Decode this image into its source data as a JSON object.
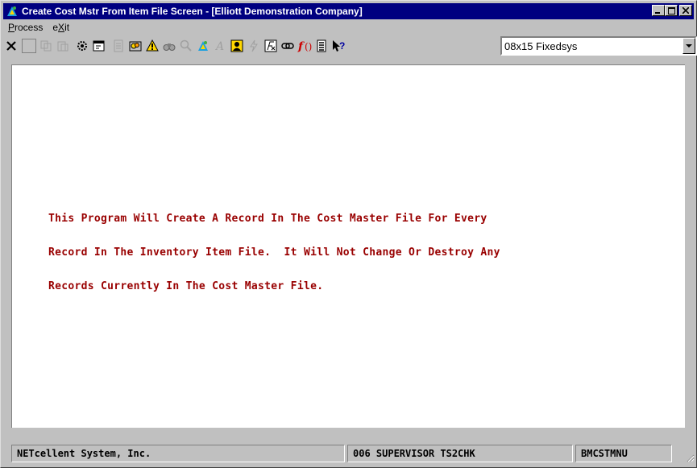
{
  "window": {
    "title": "Create Cost Mstr From Item File Screen - [Elliott Demonstration Company]",
    "controls": {
      "minimize": "_",
      "maximize": "□",
      "close": "×"
    }
  },
  "menu": {
    "items": [
      {
        "label_pre": "",
        "label_u": "P",
        "label_post": "rocess"
      },
      {
        "label_pre": "e",
        "label_u": "X",
        "label_post": "it"
      }
    ]
  },
  "toolbar": {
    "icons": [
      {
        "name": "close-x-icon",
        "glyph": "✕",
        "dim": false
      },
      {
        "name": "cut-icon",
        "glyph": "⬚",
        "dim": true
      },
      {
        "name": "copy-icon",
        "glyph": "⎘",
        "dim": true
      },
      {
        "name": "paste-icon",
        "glyph": "📋",
        "dim": true
      },
      {
        "name": "settings-icon",
        "glyph": "⚙",
        "dim": false
      },
      {
        "name": "properties-icon",
        "glyph": "🗗",
        "dim": false
      },
      {
        "name": "note-icon",
        "glyph": "▤",
        "dim": true
      },
      {
        "name": "users-icon",
        "glyph": "👥",
        "dim": false
      },
      {
        "name": "alert-icon",
        "glyph": "⚠",
        "dim": false
      },
      {
        "name": "binoculars-icon",
        "glyph": "🔭",
        "dim": true
      },
      {
        "name": "magnify-icon",
        "glyph": "🔍",
        "dim": true
      },
      {
        "name": "elliott-icon",
        "glyph": "✦",
        "dim": false
      },
      {
        "name": "font-a-icon",
        "glyph": "A",
        "dim": true
      },
      {
        "name": "person-icon",
        "glyph": "☻",
        "dim": false
      },
      {
        "name": "lightning-icon",
        "glyph": "ϟ",
        "dim": true
      },
      {
        "name": "function-icon",
        "glyph": "ƒ",
        "dim": false
      },
      {
        "name": "link-icon",
        "glyph": "⊝",
        "dim": false
      },
      {
        "name": "formula-icon",
        "glyph": "ƒ",
        "dim": false
      },
      {
        "name": "document-icon",
        "glyph": "▦",
        "dim": false
      },
      {
        "name": "help-pointer-icon",
        "glyph": "?",
        "dim": false
      }
    ],
    "font_select": {
      "value": "08x15 Fixedsys",
      "arrow": "▼"
    }
  },
  "content": {
    "lines": [
      "This Program Will Create A Record In The Cost Master File For Every",
      "Record In The Inventory Item File.  It Will Not Change Or Destroy Any",
      "Records Currently In The Cost Master File."
    ],
    "text_color": "#990000"
  },
  "statusbar": {
    "company": "NETcellent System, Inc.",
    "user": "006 SUPERVISOR TS2CHK",
    "program": "BMCSTMNU"
  }
}
